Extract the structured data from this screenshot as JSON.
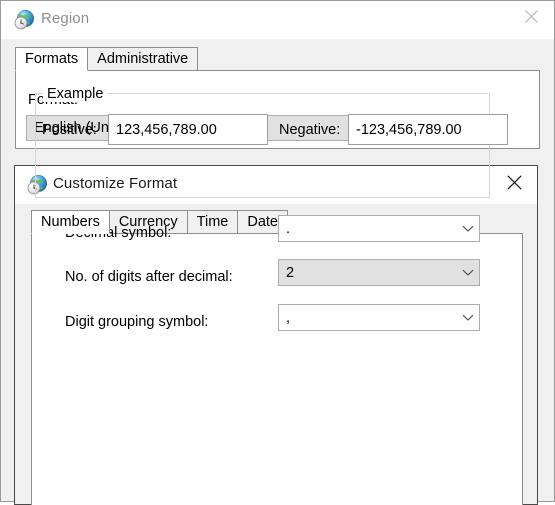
{
  "region_window": {
    "title": "Region",
    "icon": "region-globe-clock-icon",
    "close_label": "Close",
    "close_icon": "close-icon",
    "active": false,
    "tabs": [
      {
        "label": "Formats",
        "selected": true
      },
      {
        "label": "Administrative",
        "selected": false
      }
    ],
    "format_label": "Format:",
    "format_combo": {
      "value": "English (United States)",
      "icon": "chevron-down-icon",
      "state": "grey"
    }
  },
  "customize_format_window": {
    "title": "Customize Format",
    "icon": "region-globe-clock-icon",
    "close_label": "Close",
    "close_icon": "close-icon",
    "active": true,
    "tabs": [
      {
        "label": "Numbers",
        "selected": true
      },
      {
        "label": "Currency",
        "selected": false
      },
      {
        "label": "Time",
        "selected": false
      },
      {
        "label": "Date",
        "selected": false
      }
    ],
    "example_group": {
      "legend": "Example",
      "positive_label": "Positive:",
      "positive_value": "123,456,789.00",
      "negative_label": "Negative:",
      "negative_value": "-123,456,789.00"
    },
    "fields": {
      "decimal_symbol_label": "Decimal symbol:",
      "decimal_symbol_value": ".",
      "digits_after_decimal_label": "No. of digits after decimal:",
      "digits_after_decimal_value": "2",
      "digit_grouping_symbol_label": "Digit grouping symbol:",
      "digit_grouping_symbol_value": ","
    }
  },
  "colors": {
    "window_face": "#f0f0f0",
    "titlebar": "#ffffff",
    "page_white": "#ffffff",
    "inactive_title_text": "#8e8e8e",
    "active_title_text": "#1b1b1b",
    "combo_grey": "#e1e1e1",
    "border": "#8d8d8d"
  }
}
